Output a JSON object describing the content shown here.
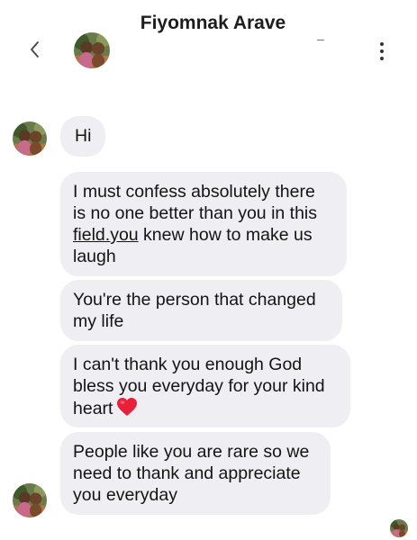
{
  "header": {
    "contact_name": "Fiyomnak Arave"
  },
  "icons": {
    "back": "chevron-left-icon",
    "menu": "more-vertical-icon",
    "heart": "red-heart-emoji"
  },
  "colors": {
    "bubble": "#eeeef3",
    "heart": "#e8203a",
    "text": "#141414"
  },
  "messages": [
    {
      "text": "Hi"
    },
    {
      "line1": "I must confess absolutely there",
      "line2": "is no one better than you in this",
      "underlined": "field.you",
      "rest": " knew how to make us",
      "line4": "laugh"
    },
    {
      "text": "You're the person that changed\nmy life"
    },
    {
      "text": "I can't thank you enough God\nbless you everyday for your kind\nheart"
    },
    {
      "text": "People like you are rare so we\nneed to thank and appreciate\nyou everyday"
    }
  ]
}
